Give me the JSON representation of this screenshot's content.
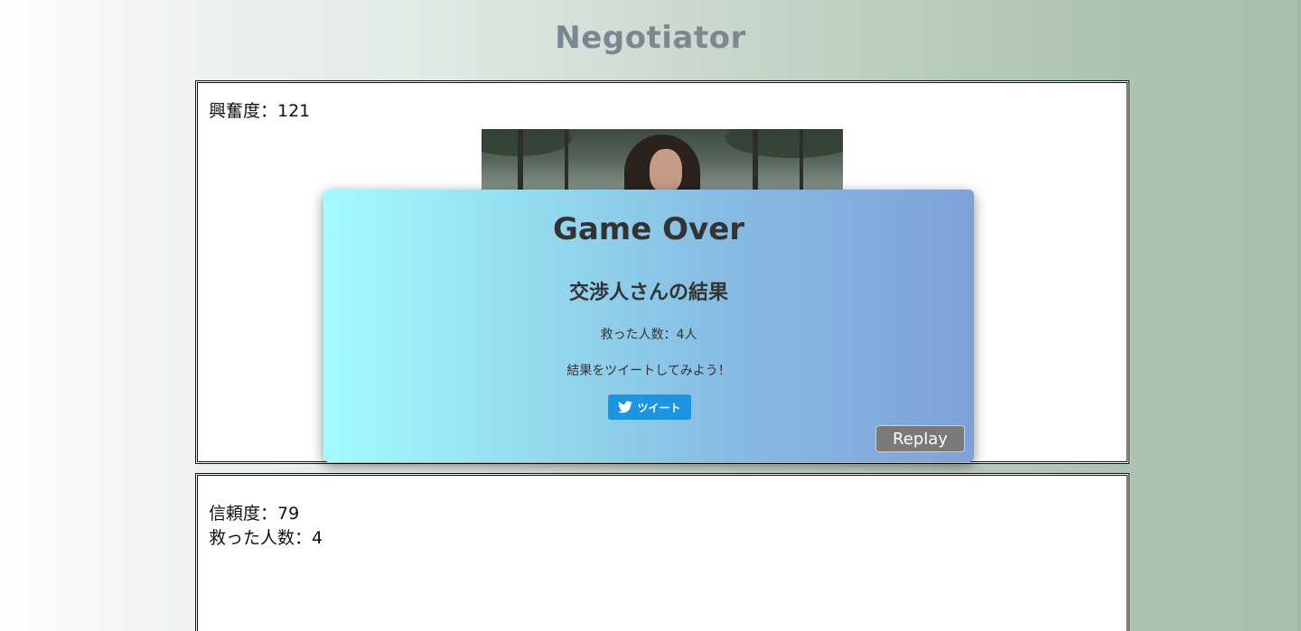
{
  "app": {
    "title": "Negotiator"
  },
  "main": {
    "excitement_text": "興奮度：121",
    "trust_text": "信頼度：79",
    "saved_text": "救った人数：4"
  },
  "modal": {
    "title": "Game Over",
    "result_heading": "交渉人さんの結果",
    "saved_result": "救った人数：4人",
    "tweet_prompt": "結果をツイートしてみよう！",
    "tweet_label": "ツイート",
    "tweet_icon": "twitter-bird-icon",
    "replay_label": "Replay"
  },
  "colors": {
    "tweet_button": "#1b95e0",
    "replay_button": "#7a7a7a",
    "modal_gradient_start": "#a3fbfd",
    "modal_gradient_end": "#7ea2d8"
  }
}
